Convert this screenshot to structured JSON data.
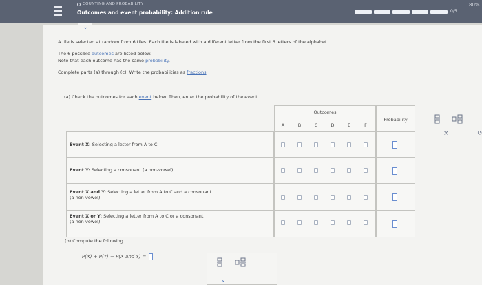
{
  "header": {
    "topic": "COUNTING AND PROBABILITY",
    "title": "Outcomes and event probability: Addition rule",
    "progress_label": "0/5",
    "battery": "80%"
  },
  "problem": {
    "intro": "A tile is selected at random from 6 tiles. Each tile is labeled with a different letter from the first 6 letters of the alphabet.",
    "line2_pre": "The 6 possible ",
    "line2_link": "outcomes",
    "line2_post": " are listed below.",
    "line3_pre": "Note that each outcome has the same ",
    "line3_link": "probability",
    "line3_post": ".",
    "line4_pre": "Complete parts (a) through (c). Write the probabilities as ",
    "line4_link": "fractions",
    "line4_post": "."
  },
  "part_a": {
    "prompt_pre": "(a) Check the outcomes for each ",
    "prompt_link": "event",
    "prompt_post": " below. Then, enter the probability of the event."
  },
  "table": {
    "outcomes_header": "Outcomes",
    "probability_header": "Probability",
    "letters": [
      "A",
      "B",
      "C",
      "D",
      "E",
      "F"
    ],
    "rows": [
      {
        "label_bold": "Event X:",
        "label_rest": " Selecting a letter from A to C",
        "line2": ""
      },
      {
        "label_bold": "Event Y:",
        "label_rest": " Selecting a consonant (a non-vowel)",
        "line2": ""
      },
      {
        "label_bold": "Event X and Y:",
        "label_rest": " Selecting a letter from A to C and a consonant",
        "line2": "(a non-vowel)"
      },
      {
        "label_bold": "Event X or Y:",
        "label_rest": " Selecting a letter from A to C or a consonant",
        "line2": "(a non-vowel)"
      }
    ]
  },
  "part_b": {
    "label": "(b) Compute the following.",
    "formula": "P(X) + P(Y) − P(X and Y) ="
  },
  "tools": {
    "fraction_icon": "fraction-icon",
    "mixed_fraction_icon": "mixed-number-icon",
    "close_icon": "close-icon",
    "undo_icon": "undo-icon"
  },
  "colors": {
    "header_bg": "#5a6272",
    "accent": "#4a74b8",
    "sheet_bg": "#f3f3f1"
  }
}
